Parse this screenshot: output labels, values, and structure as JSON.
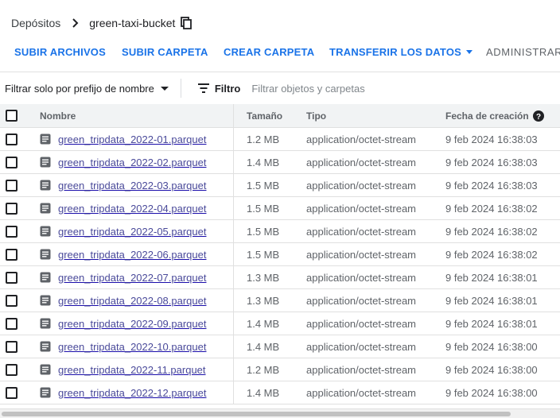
{
  "breadcrumb": {
    "root": "Depósitos",
    "current": "green-taxi-bucket",
    "icons": {
      "separator": "chevron-right-icon",
      "copy": "copy-icon"
    }
  },
  "actions": {
    "upload_files": "SUBIR ARCHIVOS",
    "upload_folder": "SUBIR CARPETA",
    "create_folder": "CREAR CARPETA",
    "transfer_data": "TRANSFERIR LOS DATOS",
    "manage": "ADMINISTRAR C"
  },
  "filter": {
    "prefix_label": "Filtrar solo por prefijo de nombre",
    "button_label": "Filtro",
    "placeholder": "Filtrar objetos y carpetas"
  },
  "table": {
    "columns": {
      "name": "Nombre",
      "size": "Tamaño",
      "type": "Tipo",
      "created": "Fecha de creación"
    },
    "rows": [
      {
        "name": "green_tripdata_2022-01.parquet",
        "size": "1.2 MB",
        "type": "application/octet-stream",
        "created": "9 feb 2024 16:38:03"
      },
      {
        "name": "green_tripdata_2022-02.parquet",
        "size": "1.4 MB",
        "type": "application/octet-stream",
        "created": "9 feb 2024 16:38:03"
      },
      {
        "name": "green_tripdata_2022-03.parquet",
        "size": "1.5 MB",
        "type": "application/octet-stream",
        "created": "9 feb 2024 16:38:03"
      },
      {
        "name": "green_tripdata_2022-04.parquet",
        "size": "1.5 MB",
        "type": "application/octet-stream",
        "created": "9 feb 2024 16:38:02"
      },
      {
        "name": "green_tripdata_2022-05.parquet",
        "size": "1.5 MB",
        "type": "application/octet-stream",
        "created": "9 feb 2024 16:38:02"
      },
      {
        "name": "green_tripdata_2022-06.parquet",
        "size": "1.5 MB",
        "type": "application/octet-stream",
        "created": "9 feb 2024 16:38:02"
      },
      {
        "name": "green_tripdata_2022-07.parquet",
        "size": "1.3 MB",
        "type": "application/octet-stream",
        "created": "9 feb 2024 16:38:01"
      },
      {
        "name": "green_tripdata_2022-08.parquet",
        "size": "1.3 MB",
        "type": "application/octet-stream",
        "created": "9 feb 2024 16:38:01"
      },
      {
        "name": "green_tripdata_2022-09.parquet",
        "size": "1.4 MB",
        "type": "application/octet-stream",
        "created": "9 feb 2024 16:38:01"
      },
      {
        "name": "green_tripdata_2022-10.parquet",
        "size": "1.4 MB",
        "type": "application/octet-stream",
        "created": "9 feb 2024 16:38:00"
      },
      {
        "name": "green_tripdata_2022-11.parquet",
        "size": "1.2 MB",
        "type": "application/octet-stream",
        "created": "9 feb 2024 16:38:00"
      },
      {
        "name": "green_tripdata_2022-12.parquet",
        "size": "1.4 MB",
        "type": "application/octet-stream",
        "created": "9 feb 2024 16:38:00"
      }
    ]
  },
  "colors": {
    "accent": "#1a73e8",
    "header_bg": "#f1f3f4",
    "border": "#e0e0e0",
    "link": "#4a4a9a"
  }
}
